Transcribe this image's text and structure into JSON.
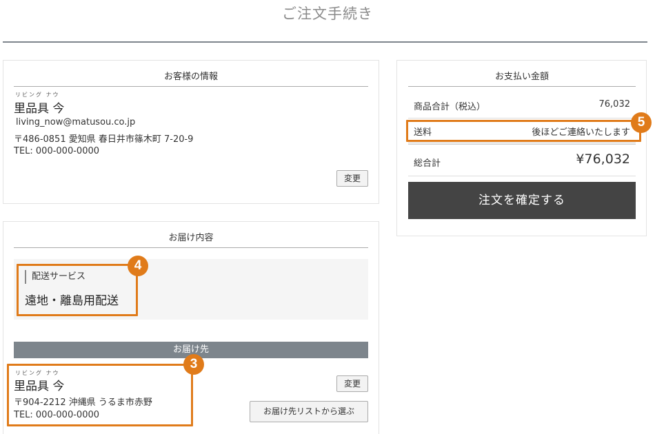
{
  "page": {
    "title": "ご注文手続き"
  },
  "customer": {
    "header": "お客様の情報",
    "ruby": "リビング ナウ",
    "name": "里品具 今",
    "email": "living_now@matusou.co.jp",
    "address": "〒486-0851 愛知県 春日井市篠木町 7-20-9",
    "tel": "TEL: 000-000-0000",
    "change_label": "変更"
  },
  "delivery": {
    "header": "お届け内容",
    "service_label": "配送サービス",
    "service_value": "遠地・離島用配送",
    "destination_header": "お届け先",
    "ruby": "リビング ナウ",
    "name": "里品具 今",
    "address": "〒904-2212 沖縄県 うるま市赤野",
    "tel": "TEL: 000-000-0000",
    "change_label": "変更",
    "choose_list_label": "お届け先リストから選ぶ"
  },
  "payment": {
    "header": "お支払い金額",
    "subtotal_label": "商品合計（税込）",
    "subtotal_value": "76,032",
    "shipping_label": "送料",
    "shipping_value": "後ほどご連絡いたします",
    "total_label": "総合計",
    "total_value": "¥76,032",
    "confirm_label": "注文を確定する"
  },
  "annotations": {
    "badge_3": "3",
    "badge_4": "4",
    "badge_5": "5",
    "color": "#e07b1a"
  }
}
